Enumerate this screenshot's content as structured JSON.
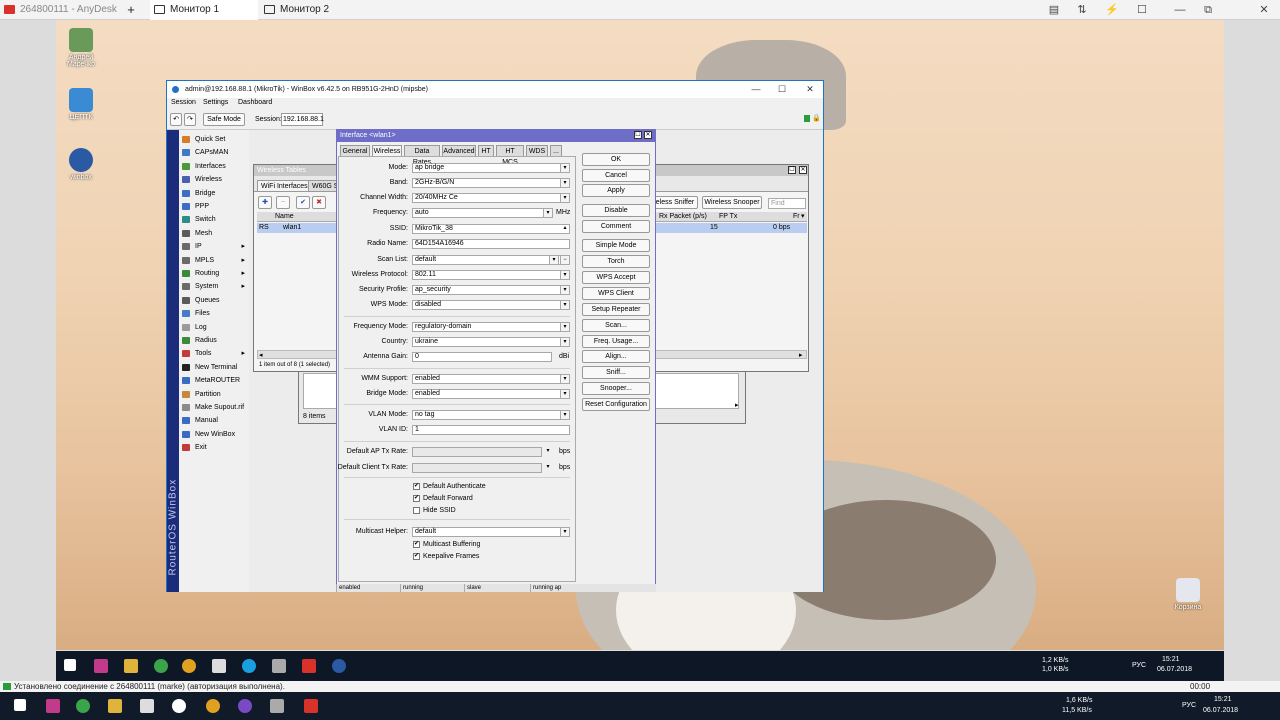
{
  "anydesk": {
    "tab_session": "264800111 - AnyDesk",
    "tab_monitor1": "Монитор 1",
    "tab_monitor2": "Монитор 2",
    "plus": "+",
    "status": "Установлено соединение с 264800111 (marke) (авторизация выполнена).",
    "timer": "00:00"
  },
  "desktop": {
    "icons": [
      {
        "label": "Андрей Маречко"
      },
      {
        "label": "ЦЕПТК"
      },
      {
        "label": "winbox"
      },
      {
        "label": "Корзина"
      }
    ]
  },
  "winbox": {
    "title": "admin@192.168.88.1 (MikroTik) - WinBox v6.42.5 on RB951G-2HnD (mipsbe)",
    "menu": [
      "Session",
      "Settings",
      "Dashboard"
    ],
    "safe_mode": "Safe Mode",
    "session_label": "Session:",
    "session_value": "192.168.88.1",
    "vertical_label": "RouterOS WinBox",
    "sidebar": [
      {
        "label": "Quick Set",
        "color": "#d77c2a"
      },
      {
        "label": "CAPsMAN",
        "color": "#3f78c4"
      },
      {
        "label": "Interfaces",
        "color": "#4a9a3a"
      },
      {
        "label": "Wireless",
        "color": "#4a5fb0"
      },
      {
        "label": "Bridge",
        "color": "#3b6ec4"
      },
      {
        "label": "PPP",
        "color": "#3b6ec4"
      },
      {
        "label": "Switch",
        "color": "#2f8a8a"
      },
      {
        "label": "Mesh",
        "color": "#5a5a5a"
      },
      {
        "label": "IP",
        "color": "#6a6a6a"
      },
      {
        "label": "MPLS",
        "color": "#6a6a6a"
      },
      {
        "label": "Routing",
        "color": "#3a8a3a"
      },
      {
        "label": "System",
        "color": "#6a6a6a"
      },
      {
        "label": "Queues",
        "color": "#5a5a5a"
      },
      {
        "label": "Files",
        "color": "#4a7ac4"
      },
      {
        "label": "Log",
        "color": "#9a9a9a"
      },
      {
        "label": "Radius",
        "color": "#3a8a3a"
      },
      {
        "label": "Tools",
        "color": "#c43a3a"
      },
      {
        "label": "New Terminal",
        "color": "#222"
      },
      {
        "label": "MetaROUTER",
        "color": "#3a6ac4"
      },
      {
        "label": "Partition",
        "color": "#c48a3a"
      },
      {
        "label": "Make Supout.rif",
        "color": "#8a8a8a"
      },
      {
        "label": "Manual",
        "color": "#3a6ac4"
      },
      {
        "label": "New WinBox",
        "color": "#3a6ac4"
      },
      {
        "label": "Exit",
        "color": "#c43a3a"
      }
    ]
  },
  "wireless_tables": {
    "title": "Wireless Tables",
    "tabs": [
      "WiFi Interfaces",
      "W60G St"
    ],
    "btn_sniffer": "eless Sniffer",
    "btn_snooper": "Wireless Snooper",
    "find_placeholder": "Find",
    "col_name": "Name",
    "col_rx": "Rx Packet (p/s)",
    "col_fptx": "FP Tx",
    "col_fr": "Fr",
    "row": {
      "flags": "RS",
      "name": "wlan1",
      "rx": "15",
      "fptx": "0 bps"
    },
    "status": "1 item out of 8 (1 selected)",
    "back_status": "8 items"
  },
  "interface": {
    "title": "Interface <wlan1>",
    "tabs": [
      "General",
      "Wireless",
      "Data Rates",
      "Advanced",
      "HT",
      "HT MCS",
      "WDS",
      "..."
    ],
    "fields": {
      "mode": {
        "label": "Mode:",
        "value": "ap bridge"
      },
      "band": {
        "label": "Band:",
        "value": "2GHz-B/G/N"
      },
      "channel_width": {
        "label": "Channel Width:",
        "value": "20/40MHz Ce"
      },
      "frequency": {
        "label": "Frequency:",
        "value": "auto",
        "unit": "MHz"
      },
      "ssid": {
        "label": "SSID:",
        "value": "MikroTik_38"
      },
      "radio_name": {
        "label": "Radio Name:",
        "value": "64D154A16946"
      },
      "scan_list": {
        "label": "Scan List:",
        "value": "default"
      },
      "wireless_protocol": {
        "label": "Wireless Protocol:",
        "value": "802.11"
      },
      "security_profile": {
        "label": "Security Profile:",
        "value": "ap_security"
      },
      "wps_mode": {
        "label": "WPS Mode:",
        "value": "disabled"
      },
      "frequency_mode": {
        "label": "Frequency Mode:",
        "value": "regulatory-domain"
      },
      "country": {
        "label": "Country:",
        "value": "ukraine"
      },
      "antenna_gain": {
        "label": "Antenna Gain:",
        "value": "0",
        "unit": "dBi"
      },
      "wmm_support": {
        "label": "WMM Support:",
        "value": "enabled"
      },
      "bridge_mode": {
        "label": "Bridge Mode:",
        "value": "enabled"
      },
      "vlan_mode": {
        "label": "VLAN Mode:",
        "value": "no tag"
      },
      "vlan_id": {
        "label": "VLAN ID:",
        "value": "1"
      },
      "default_ap_tx": {
        "label": "Default AP Tx Rate:",
        "value": "",
        "unit": "bps"
      },
      "default_client_tx": {
        "label": "Default Client Tx Rate:",
        "value": "",
        "unit": "bps"
      },
      "multicast_helper": {
        "label": "Multicast Helper:",
        "value": "default"
      }
    },
    "checks": {
      "default_authenticate": "Default Authenticate",
      "default_forward": "Default Forward",
      "hide_ssid": "Hide SSID",
      "multicast_buffering": "Multicast Buffering",
      "keepalive_frames": "Keepalive Frames"
    },
    "buttons": [
      "OK",
      "Cancel",
      "Apply",
      "Disable",
      "Comment",
      "Simple Mode",
      "Torch",
      "WPS Accept",
      "WPS Client",
      "Setup Repeater",
      "Scan...",
      "Freq. Usage...",
      "Align...",
      "Sniff...",
      "Snooper...",
      "Reset Configuration"
    ],
    "status": [
      "enabled",
      "running",
      "slave",
      "running ap"
    ]
  },
  "taskbar_remote": {
    "net_up": "1,2 KB/s",
    "net_down": "1,0 KB/s",
    "lang": "РУС",
    "time": "15:21",
    "date": "06.07.2018"
  },
  "taskbar_local": {
    "net_up": "1,6 KB/s",
    "net_down": "11,5 KB/s",
    "lang": "РУС",
    "time": "15:21",
    "date": "06.07.2018"
  },
  "glyphs": {
    "check": "✔",
    "cross": "✖",
    "plus": "✚",
    "minus": "−",
    "dd": "▾",
    "up": "▴",
    "left": "◂",
    "right": "▸",
    "min": "—",
    "max": "☐",
    "close": "✕",
    "restore": "⧉",
    "undo": "↶",
    "redo": "↷",
    "lock": "🔒",
    "updown": "⇅",
    "flash": "⚡",
    "chat": "▤",
    "fr_dd": "▾"
  }
}
